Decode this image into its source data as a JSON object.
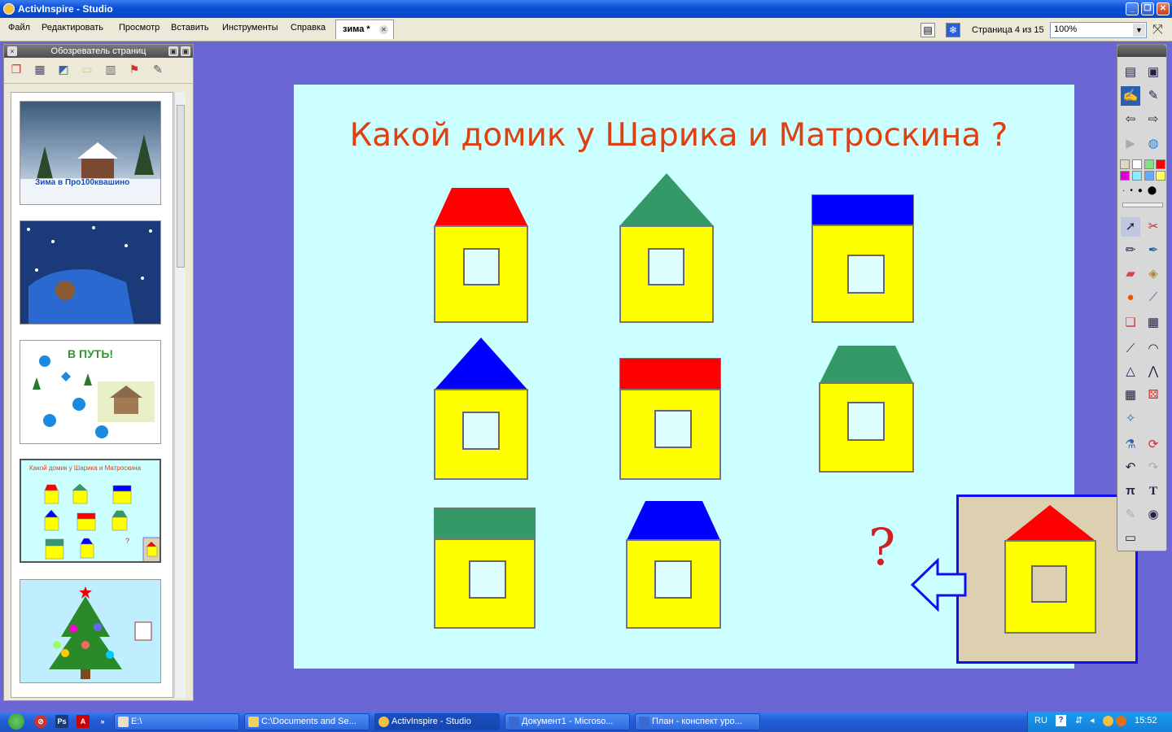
{
  "window": {
    "title": "ActivInspire - Studio",
    "minimize": "_",
    "maximize": "❐",
    "close": "✕"
  },
  "menu": [
    "Файл",
    "Редактировать",
    "Просмотр",
    "Вставить",
    "Инструменты",
    "Справка"
  ],
  "doc_tab": {
    "label": "зима *",
    "close": "✕"
  },
  "pagebar": {
    "page_label": "Страница 4 из 15",
    "zoom_value": "100%",
    "zoom_arrow": "▼"
  },
  "page_browser": {
    "title": "Обозреватель страниц",
    "pin": "▣",
    "close": "×",
    "thumbnails": [
      {
        "caption": "Зима в Про100квашино",
        "kind": "winter"
      },
      {
        "caption": "",
        "kind": "car"
      },
      {
        "caption": "В ПУТЬ!",
        "kind": "path"
      },
      {
        "caption": "Какой домик у Шарика и Матроскина",
        "kind": "houses",
        "selected": true
      },
      {
        "caption": "",
        "kind": "tree"
      }
    ]
  },
  "slide": {
    "title": "Какой домик у Шарика и Матроскина ?",
    "question_mark": "?",
    "colors": {
      "red": "#ff0000",
      "green": "#339966",
      "blue": "#0000ff",
      "yellow": "#ffff00",
      "bg": "#ccffff"
    },
    "houses": [
      {
        "roof": "trapezoid",
        "color": "red"
      },
      {
        "roof": "triangle",
        "color": "green"
      },
      {
        "roof": "rect",
        "color": "blue"
      },
      {
        "roof": "triangle",
        "color": "blue"
      },
      {
        "roof": "rect",
        "color": "red"
      },
      {
        "roof": "trapezoid",
        "color": "green"
      },
      {
        "roof": "rect",
        "color": "green"
      },
      {
        "roof": "trapezoid",
        "color": "blue"
      }
    ],
    "answer_house": {
      "roof": "triangle",
      "color": "red"
    }
  },
  "toolbox": {
    "tools": [
      "page-icon",
      "profile-icon",
      "signature-icon",
      "handwriting-icon",
      "back-icon",
      "forward-icon",
      "play-icon",
      "globe-icon",
      "select-icon",
      "tools-icon",
      "pen-icon",
      "highlighter-icon",
      "eraser-icon",
      "fill-icon",
      "shape-icon",
      "connector-icon",
      "clipart-icon",
      "media-icon",
      "ruler-icon",
      "protractor-icon",
      "triangle-ruler-icon",
      "compass-icon",
      "calculator-icon",
      "dice-icon",
      "magic-icon",
      "spotlight-icon",
      "reset-icon",
      "undo-icon",
      "redo-icon",
      "pi-icon",
      "text-icon",
      "recognize-icon",
      "camera-icon",
      "screen-icon"
    ],
    "swatches": [
      "#e0d8c0",
      "#ffffff",
      "#88dd88",
      "#ff0000",
      "#dd00dd",
      "#88eeff",
      "#66aaff",
      "#ffff66"
    ]
  },
  "taskbar": {
    "tasks": [
      {
        "label": "E:\\",
        "active": false
      },
      {
        "label": "C:\\Documents and Se...",
        "active": false
      },
      {
        "label": "ActivInspire - Studio",
        "active": true
      },
      {
        "label": "Документ1 - Microso...",
        "active": false
      },
      {
        "label": "План - конспект уро...",
        "active": false
      }
    ],
    "lang": "RU",
    "clock": "15:52",
    "quicklaunch_more": "»"
  }
}
